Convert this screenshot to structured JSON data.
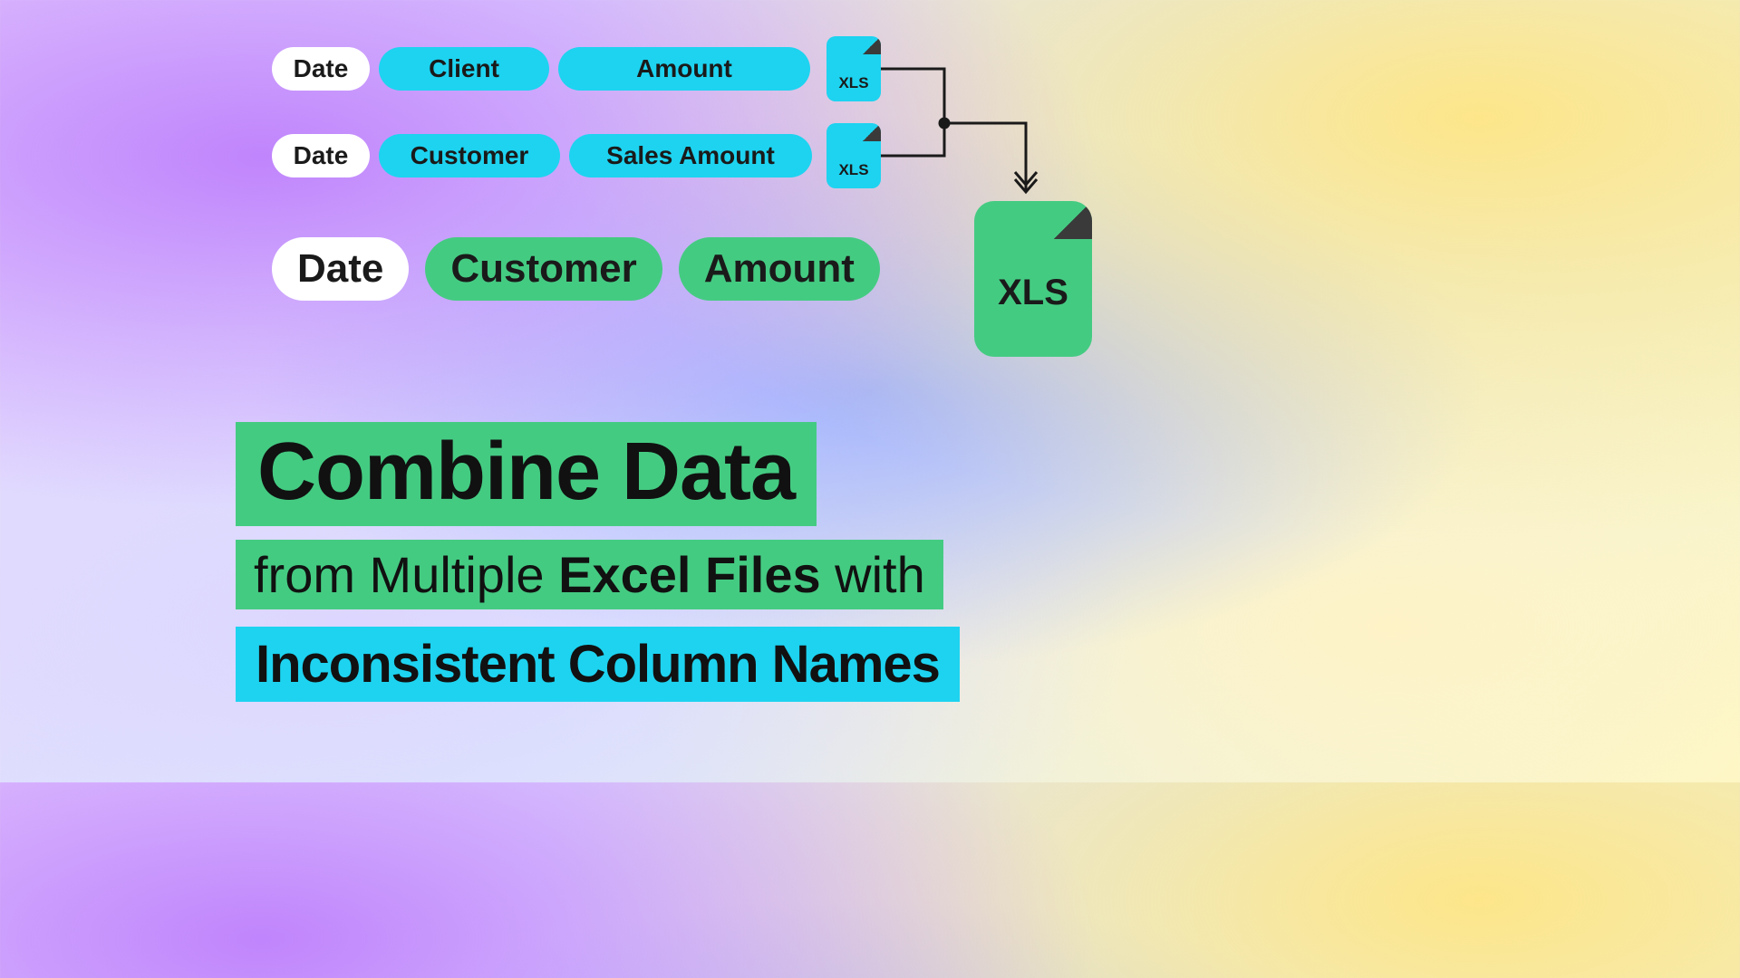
{
  "rows": {
    "r1": {
      "date": "Date",
      "col2": "Client",
      "col3": "Amount"
    },
    "r2": {
      "date": "Date",
      "col2": "Customer",
      "col3": "Sales Amount"
    },
    "r3": {
      "date": "Date",
      "col2": "Customer",
      "col3": "Amount"
    }
  },
  "file_label": "XLS",
  "title": {
    "line1": "Combine Data",
    "line2_pre": "from Multiple ",
    "line2_bold": "Excel Files",
    "line2_post": " with",
    "line3": "Inconsistent Column Names"
  },
  "colors": {
    "cyan": "#1dd3f0",
    "green": "#44cb82",
    "white": "#ffffff",
    "dark": "#1a1a1a"
  }
}
